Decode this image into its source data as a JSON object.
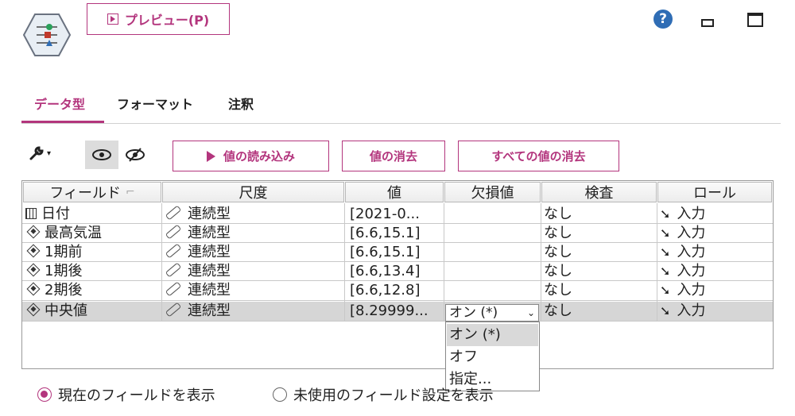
{
  "toolbar": {
    "preview_label": "プレビュー(P)",
    "help_glyph": "?",
    "read_values_label": "値の読み込み",
    "clear_values_label": "値の消去",
    "clear_all_values_label": "すべての値の消去"
  },
  "tabs": [
    {
      "label": "データ型",
      "active": true
    },
    {
      "label": "フォーマット",
      "active": false
    },
    {
      "label": "注釈",
      "active": false
    }
  ],
  "table": {
    "columns": [
      "フィールド",
      "尺度",
      "値",
      "欠損値",
      "検査",
      "ロール"
    ],
    "rows": [
      {
        "field": "日付",
        "field_icon": "calendar-icon",
        "measure": "連続型",
        "values": "[2021-0...",
        "missing": "",
        "check": "なし",
        "role": "入力",
        "selected": false
      },
      {
        "field": "最高気温",
        "field_icon": "numeric-field-icon",
        "measure": "連続型",
        "values": "[6.6,15.1]",
        "missing": "",
        "check": "なし",
        "role": "入力",
        "selected": false
      },
      {
        "field": "1期前",
        "field_icon": "numeric-field-icon",
        "measure": "連続型",
        "values": "[6.6,15.1]",
        "missing": "",
        "check": "なし",
        "role": "入力",
        "selected": false
      },
      {
        "field": "1期後",
        "field_icon": "numeric-field-icon",
        "measure": "連続型",
        "values": "[6.6,13.4]",
        "missing": "",
        "check": "なし",
        "role": "入力",
        "selected": false
      },
      {
        "field": "2期後",
        "field_icon": "numeric-field-icon",
        "measure": "連続型",
        "values": "[6.6,12.8]",
        "missing": "",
        "check": "なし",
        "role": "入力",
        "selected": false
      },
      {
        "field": "中央値",
        "field_icon": "numeric-field-icon",
        "measure": "連続型",
        "values": "[8.29999...",
        "missing": "オン (*)",
        "check": "なし",
        "role": "入力",
        "selected": true
      }
    ]
  },
  "missing_dropdown": {
    "selected": "オン (*)",
    "options": [
      "オン (*)",
      "オフ",
      "指定..."
    ],
    "highlighted_index": 0
  },
  "radios": [
    {
      "label": "現在のフィールドを表示",
      "checked": true
    },
    {
      "label": "未使用のフィールド設定を表示",
      "checked": false
    }
  ],
  "colors": {
    "accent": "#b3357d",
    "help": "#2f6db5"
  }
}
